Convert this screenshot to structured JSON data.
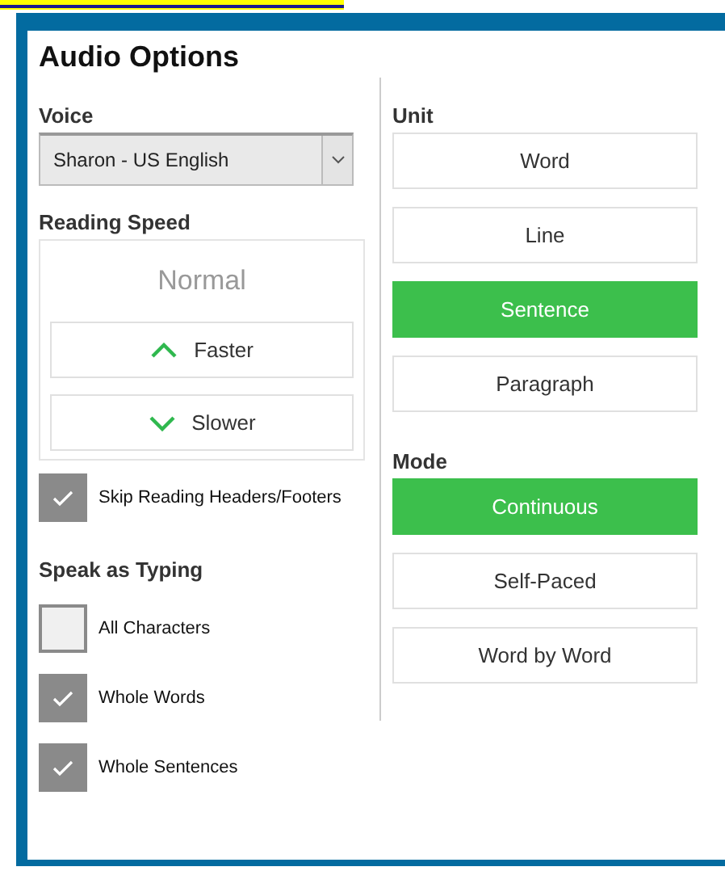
{
  "dialog": {
    "title": "Audio Options"
  },
  "voice": {
    "label": "Voice",
    "value": "Sharon - US English"
  },
  "reading_speed": {
    "label": "Reading Speed",
    "value": "Normal",
    "buttons": [
      {
        "label": "Faster",
        "kind": "up"
      },
      {
        "label": "Slower",
        "kind": "down"
      }
    ]
  },
  "skip_headers": {
    "label": "Skip Reading Headers/Footers",
    "checked": true
  },
  "speak_as_typing": {
    "label": "Speak as Typing",
    "options": [
      {
        "label": "All Characters",
        "checked": false
      },
      {
        "label": "Whole Words",
        "checked": true
      },
      {
        "label": "Whole Sentences",
        "checked": true
      }
    ]
  },
  "unit": {
    "label": "Unit",
    "options": [
      {
        "label": "Word",
        "selected": false
      },
      {
        "label": "Line",
        "selected": false
      },
      {
        "label": "Sentence",
        "selected": true
      },
      {
        "label": "Paragraph",
        "selected": false
      }
    ]
  },
  "mode": {
    "label": "Mode",
    "options": [
      {
        "label": "Continuous",
        "selected": true
      },
      {
        "label": "Self-Paced",
        "selected": false
      },
      {
        "label": "Word by Word",
        "selected": false
      }
    ]
  }
}
